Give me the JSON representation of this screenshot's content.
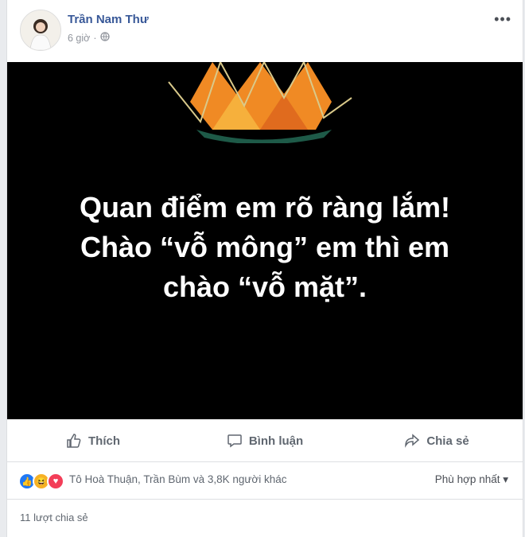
{
  "post": {
    "author": "Trần Nam Thư",
    "time": "6 giờ",
    "separator": "·",
    "more": "•••",
    "text_lines": [
      "Quan điểm em rõ ràng lắm!",
      "Chào “vỗ mông” em thì em",
      "chào “vỗ mặt”."
    ]
  },
  "actions": {
    "like": "Thích",
    "comment": "Bình luận",
    "share": "Chia sẻ"
  },
  "reactions": {
    "names": "Tô Hoà Thuận, Trần Bùm và 3,8K người khác",
    "sort": "Phù hợp nhất ▾"
  },
  "shares": "11 lượt chia sẻ",
  "colors": {
    "author": "#385898",
    "like_blue": "#2078f4",
    "haha_yellow": "#f7b125",
    "love_red": "#f33e58"
  }
}
